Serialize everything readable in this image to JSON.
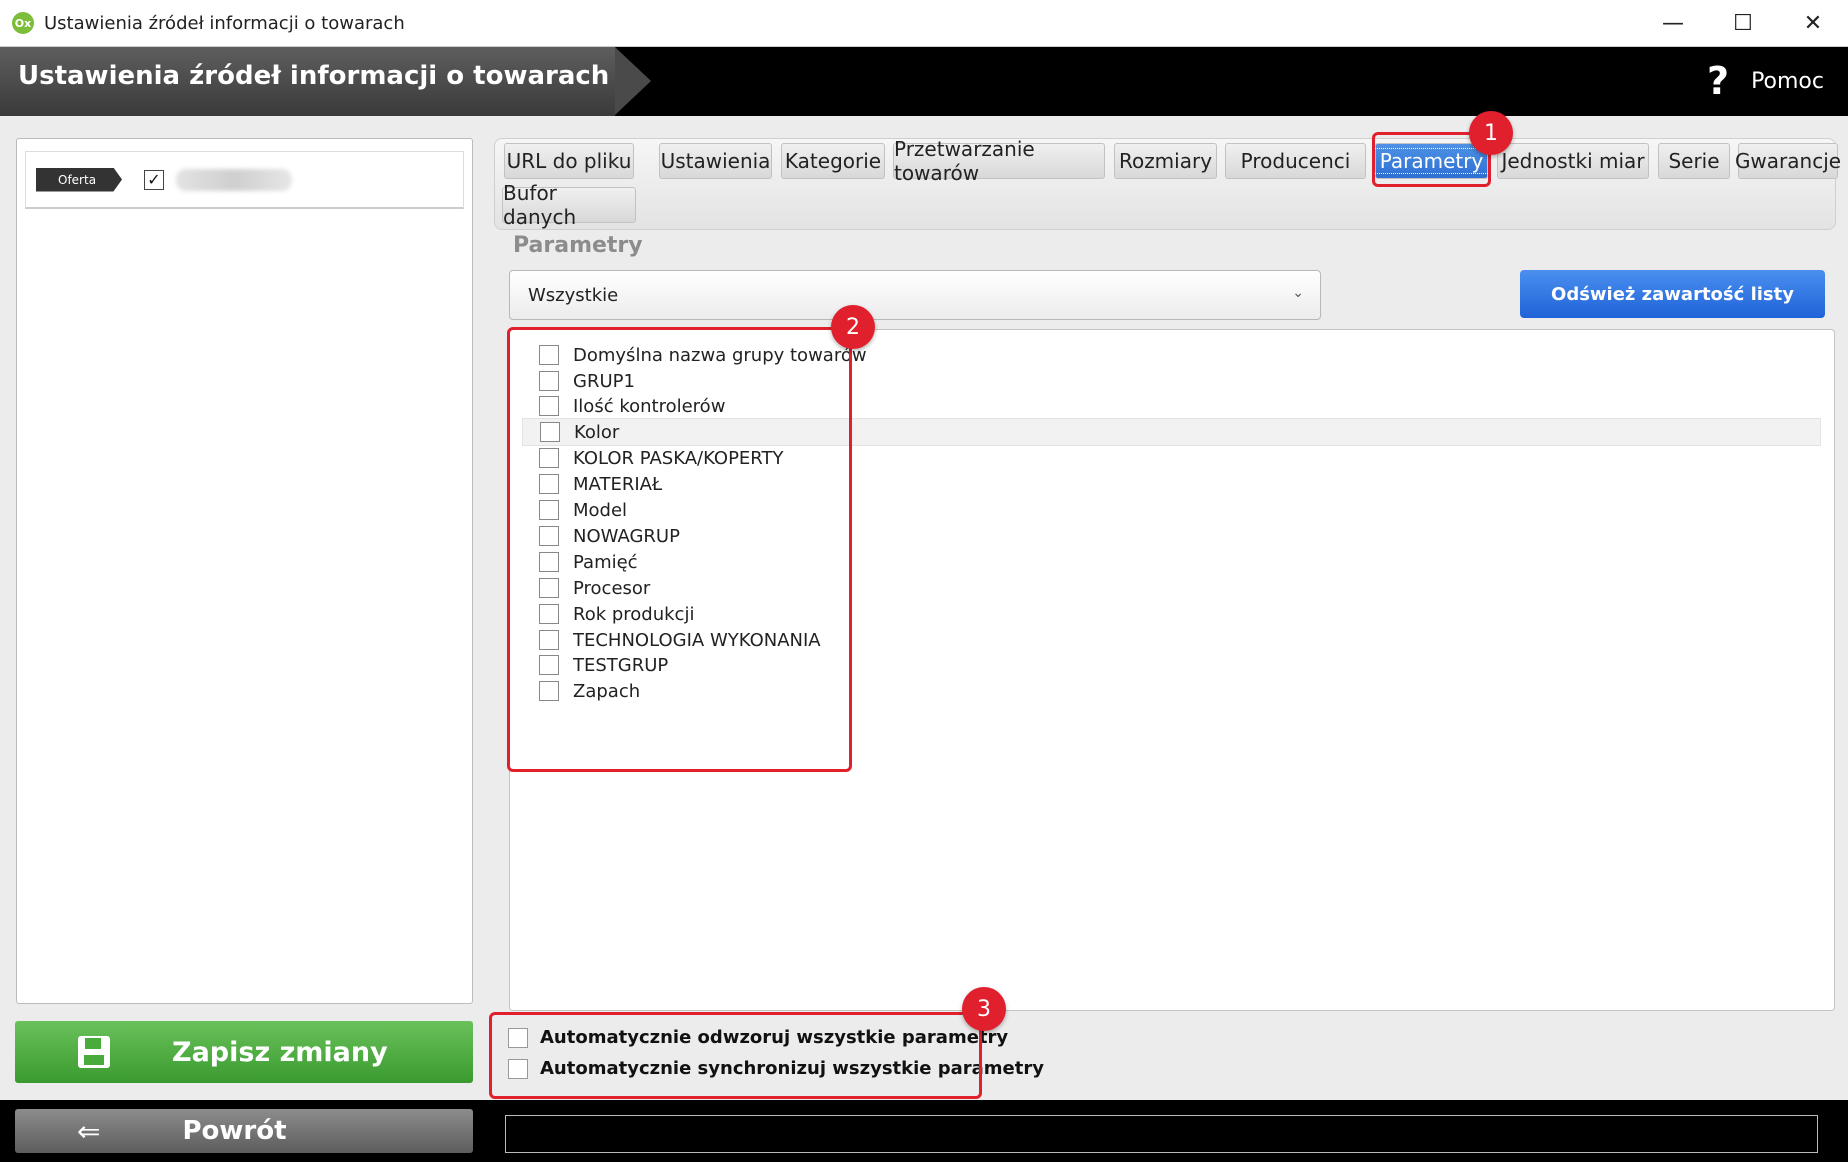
{
  "window": {
    "title": "Ustawienia źródeł informacji o towarach",
    "app_icon": "app-logo-icon",
    "minimize": "—",
    "maximize": "☐",
    "close": "✕"
  },
  "header": {
    "title": "Ustawienia źródeł informacji o towarach",
    "help_icon": "?",
    "help_label": "Pomoc"
  },
  "sources": [
    {
      "tag": "Oferta",
      "checked": "✓"
    }
  ],
  "tabs": [
    {
      "label": "URL do pliku"
    },
    {
      "label": "Ustawienia"
    },
    {
      "label": "Kategorie"
    },
    {
      "label": "Przetwarzanie towarów"
    },
    {
      "label": "Rozmiary"
    },
    {
      "label": "Producenci"
    },
    {
      "label": "Parametry",
      "active": true
    },
    {
      "label": "Jednostki miar"
    },
    {
      "label": "Serie"
    },
    {
      "label": "Gwarancje"
    },
    {
      "label": "Bufor danych"
    }
  ],
  "section": {
    "title": "Parametry"
  },
  "filter": {
    "value": "Wszystkie",
    "chevron": "⌄"
  },
  "refresh_button": "Odśwież zawartość listy",
  "parameters": [
    "Domyślna nazwa grupy towarów",
    "GRUP1",
    "Ilość kontrolerów",
    "Kolor",
    "KOLOR PASKA/KOPERTY",
    "MATERIAŁ",
    "Model",
    "NOWAGRUP",
    "Pamięć",
    "Procesor",
    "Rok produkcji",
    "TECHNOLOGIA WYKONANIA",
    "TESTGRUP",
    "Zapach"
  ],
  "options": [
    "Automatycznie odwzoruj wszystkie parametry",
    "Automatycznie synchronizuj wszystkie parametry"
  ],
  "save_button": "Zapisz zmiany",
  "back_button": {
    "icon": "⇐",
    "label": "Powrót"
  },
  "annotations": [
    "1",
    "2",
    "3"
  ],
  "colors": {
    "accent_red": "#e0202d",
    "save_green": "#4aab3d",
    "tab_active_blue": "#2d6fd2",
    "refresh_blue": "#1f63d8"
  }
}
